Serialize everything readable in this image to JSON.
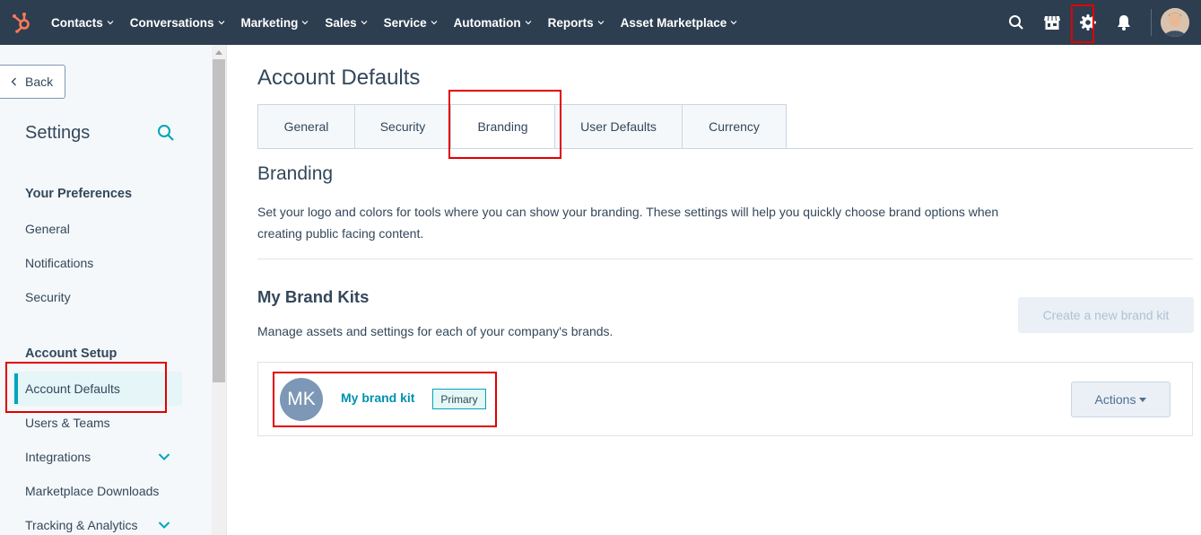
{
  "topnav": {
    "items": [
      {
        "label": "Contacts"
      },
      {
        "label": "Conversations"
      },
      {
        "label": "Marketing"
      },
      {
        "label": "Sales"
      },
      {
        "label": "Service"
      },
      {
        "label": "Automation"
      },
      {
        "label": "Reports"
      },
      {
        "label": "Asset Marketplace"
      }
    ],
    "icons": [
      "search-icon",
      "marketplace-icon",
      "gear-icon",
      "bell-icon"
    ],
    "bg_color": "#2d3e50",
    "logo_color": "#ff7a59"
  },
  "sidebar": {
    "back_label": "Back",
    "title": "Settings",
    "sections": [
      {
        "title": "Your Preferences",
        "links": [
          "General",
          "Notifications",
          "Security"
        ]
      },
      {
        "title": "Account Setup",
        "links": [
          "Account Defaults",
          "Users & Teams",
          "Integrations",
          "Marketplace Downloads",
          "Tracking & Analytics"
        ]
      }
    ],
    "active_link": "Account Defaults",
    "accent_color": "#00a4bd"
  },
  "main": {
    "title": "Account Defaults",
    "tabs": [
      {
        "label": "General"
      },
      {
        "label": "Security"
      },
      {
        "label": "Branding"
      },
      {
        "label": "User Defaults"
      },
      {
        "label": "Currency"
      }
    ],
    "active_tab": "Branding",
    "section_title": "Branding",
    "section_desc": "Set your logo and colors for tools where you can show your branding. These settings will help you quickly choose brand options when creating public facing content.",
    "kits_title": "My Brand Kits",
    "kits_desc": "Manage assets and settings for each of your company's brands.",
    "create_label": "Create a new brand kit",
    "kit": {
      "initials": "MK",
      "name": "My brand kit",
      "badge": "Primary",
      "actions_label": "Actions"
    }
  },
  "highlight_color": "#e00000"
}
